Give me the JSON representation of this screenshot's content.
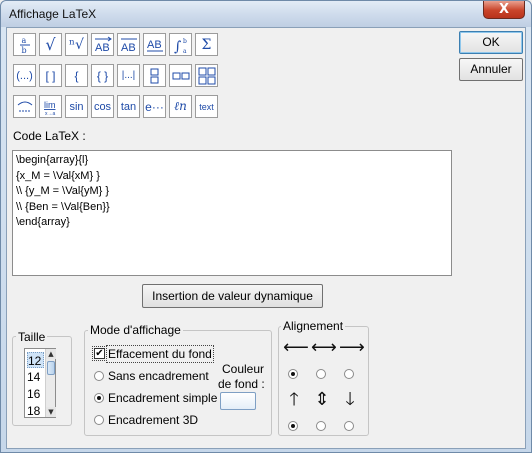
{
  "window": {
    "title": "Affichage LaTeX",
    "close_symbol": "X"
  },
  "toolbar": {
    "row1": [
      "a/b",
      "√",
      "ⁿ√",
      "AB⃗",
      "AB̅",
      "AB̲",
      "∫ᵇₐ",
      "Σ"
    ],
    "row2": [
      "(...)",
      "[ ]",
      "{",
      "{ }",
      "|...|",
      "⁘",
      "▫▫",
      "▦"
    ],
    "row3": [
      "⌒",
      "lim",
      "sin",
      "cos",
      "tan",
      "e···",
      "ℓn",
      "text"
    ]
  },
  "buttons": {
    "ok": "OK",
    "cancel": "Annuler",
    "insert": "Insertion de valeur dynamique"
  },
  "code": {
    "label": "Code LaTeX :",
    "lines": [
      "\\begin{array}{l}",
      "{x_M = \\Val{xM} }",
      "\\\\ {y_M = \\Val{yM} }",
      "\\\\ {Ben = \\Val{Ben}}",
      "\\end{array}"
    ]
  },
  "size": {
    "title": "Taille",
    "items": [
      "12",
      "14",
      "16",
      "18"
    ],
    "selected": "12"
  },
  "mode": {
    "title": "Mode d'affichage",
    "effacement": "Effacement du fond",
    "effacement_checked": true,
    "sans": "Sans encadrement",
    "simple": "Encadrement simple",
    "d3": "Encadrement 3D",
    "selected": "simple",
    "couleur_label_1": "Couleur",
    "couleur_label_2": "de fond :"
  },
  "alignment": {
    "title": "Alignement",
    "horizontal": [
      "⟵",
      "⟷",
      "⟶"
    ],
    "vertical": [
      "🡑",
      "⇕",
      "🡓"
    ],
    "h_selected": 0,
    "v_selected": 0
  }
}
